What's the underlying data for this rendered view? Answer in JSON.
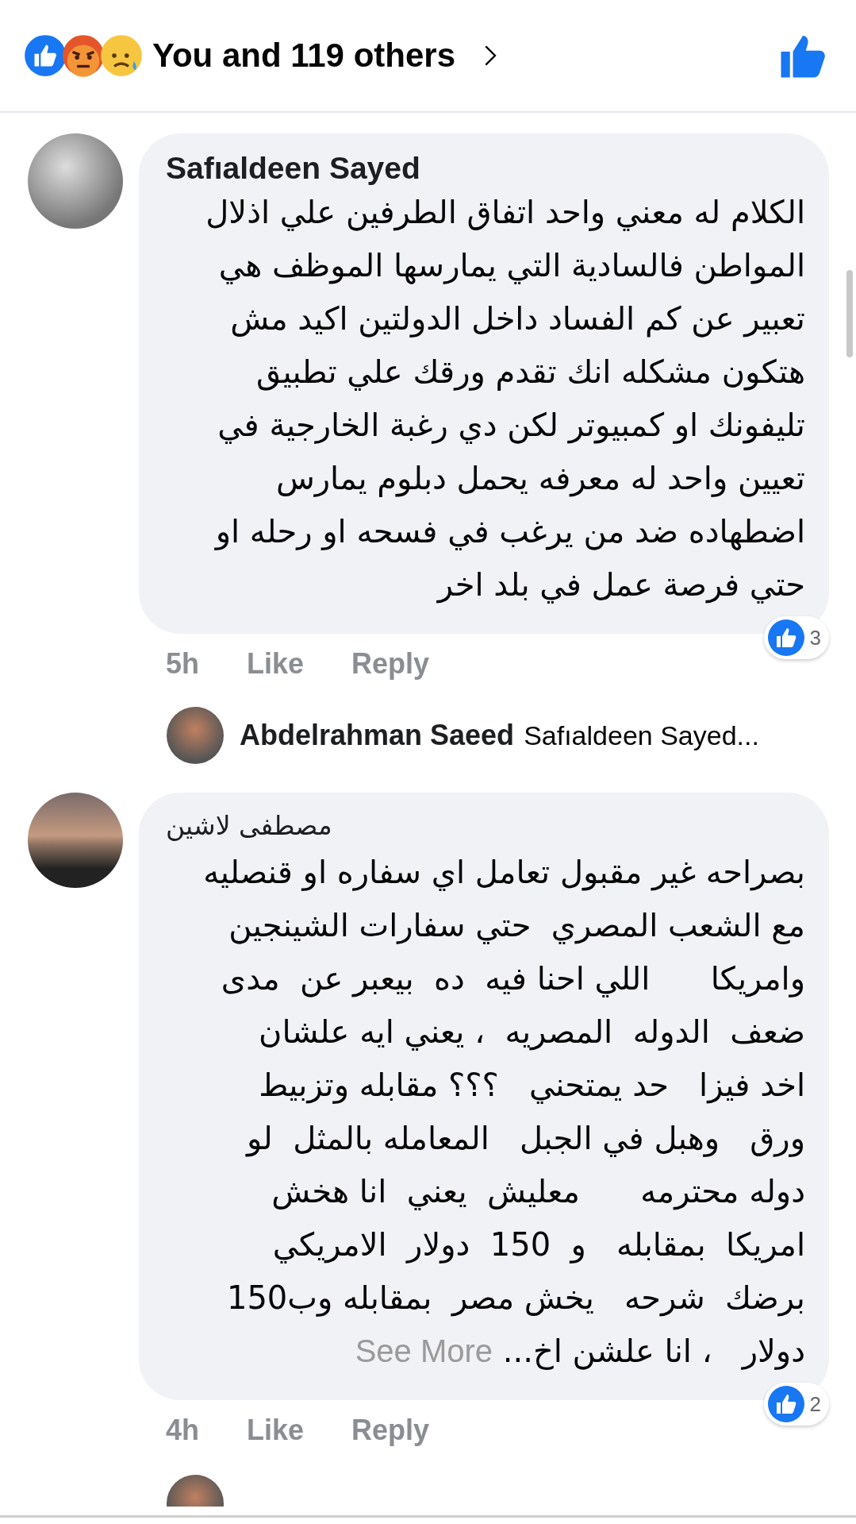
{
  "header": {
    "reactions": [
      {
        "kind": "like"
      },
      {
        "kind": "angry"
      },
      {
        "kind": "sad"
      }
    ],
    "summary": "You and 119 others"
  },
  "comments": [
    {
      "author": "Safıaldeen Sayed",
      "body": "الكلام له معني واحد اتفاق الطرفين علي اذلال\nالمواطن فالسادية التي يمارسها الموظف هي\nتعبير عن كم الفساد داخل الدولتين اكيد مش\nهتكون مشكله انك تقدم ورقك علي تطبيق\nتليفونك او كمبيوتر لكن دي رغبة الخارجية في\nتعيين واحد له معرفه يحمل دبلوم يمارس\nاضطهاده ضد من يرغب في فسحه او رحله او\nحتي فرصة عمل في بلد اخر",
      "time": "5h",
      "like_label": "Like",
      "reply_label": "Reply",
      "reaction_count": "3",
      "replies": [
        {
          "kind": "preview",
          "author": "Abdelrahman Saeed",
          "preview": "Safıaldeen Sayed..."
        }
      ]
    },
    {
      "author": "مصطفى لاشين",
      "body": "بصراحه غير مقبول تعامل اي سفاره او قنصليه\nمع الشعب المصري  حتي سفارات الشينجين\nوامريكا      اللي احنا فيه  ده  بيعبر عن  مدى\nضعف  الدوله  المصريه  ، يعني ايه علشان\nاخد فيزا   حد يمتحني   ؟؟؟ مقابله وتزبيط\nورق   وهبل في الجبل   المعامله بالمثل  لو\nدوله محترمه      معليش  يعني  انا هخش\nامريكا  بمقابله   و  150  دولار  الامريكي\nبرضك  شرحه   يخش مصر  بمقابله وب150\nدولار   ، انا علشن اخ...",
      "see_more": "See More",
      "time": "4h",
      "like_label": "Like",
      "reply_label": "Reply",
      "reaction_count": "2",
      "replies": [
        {
          "kind": "cut_off"
        }
      ]
    }
  ]
}
